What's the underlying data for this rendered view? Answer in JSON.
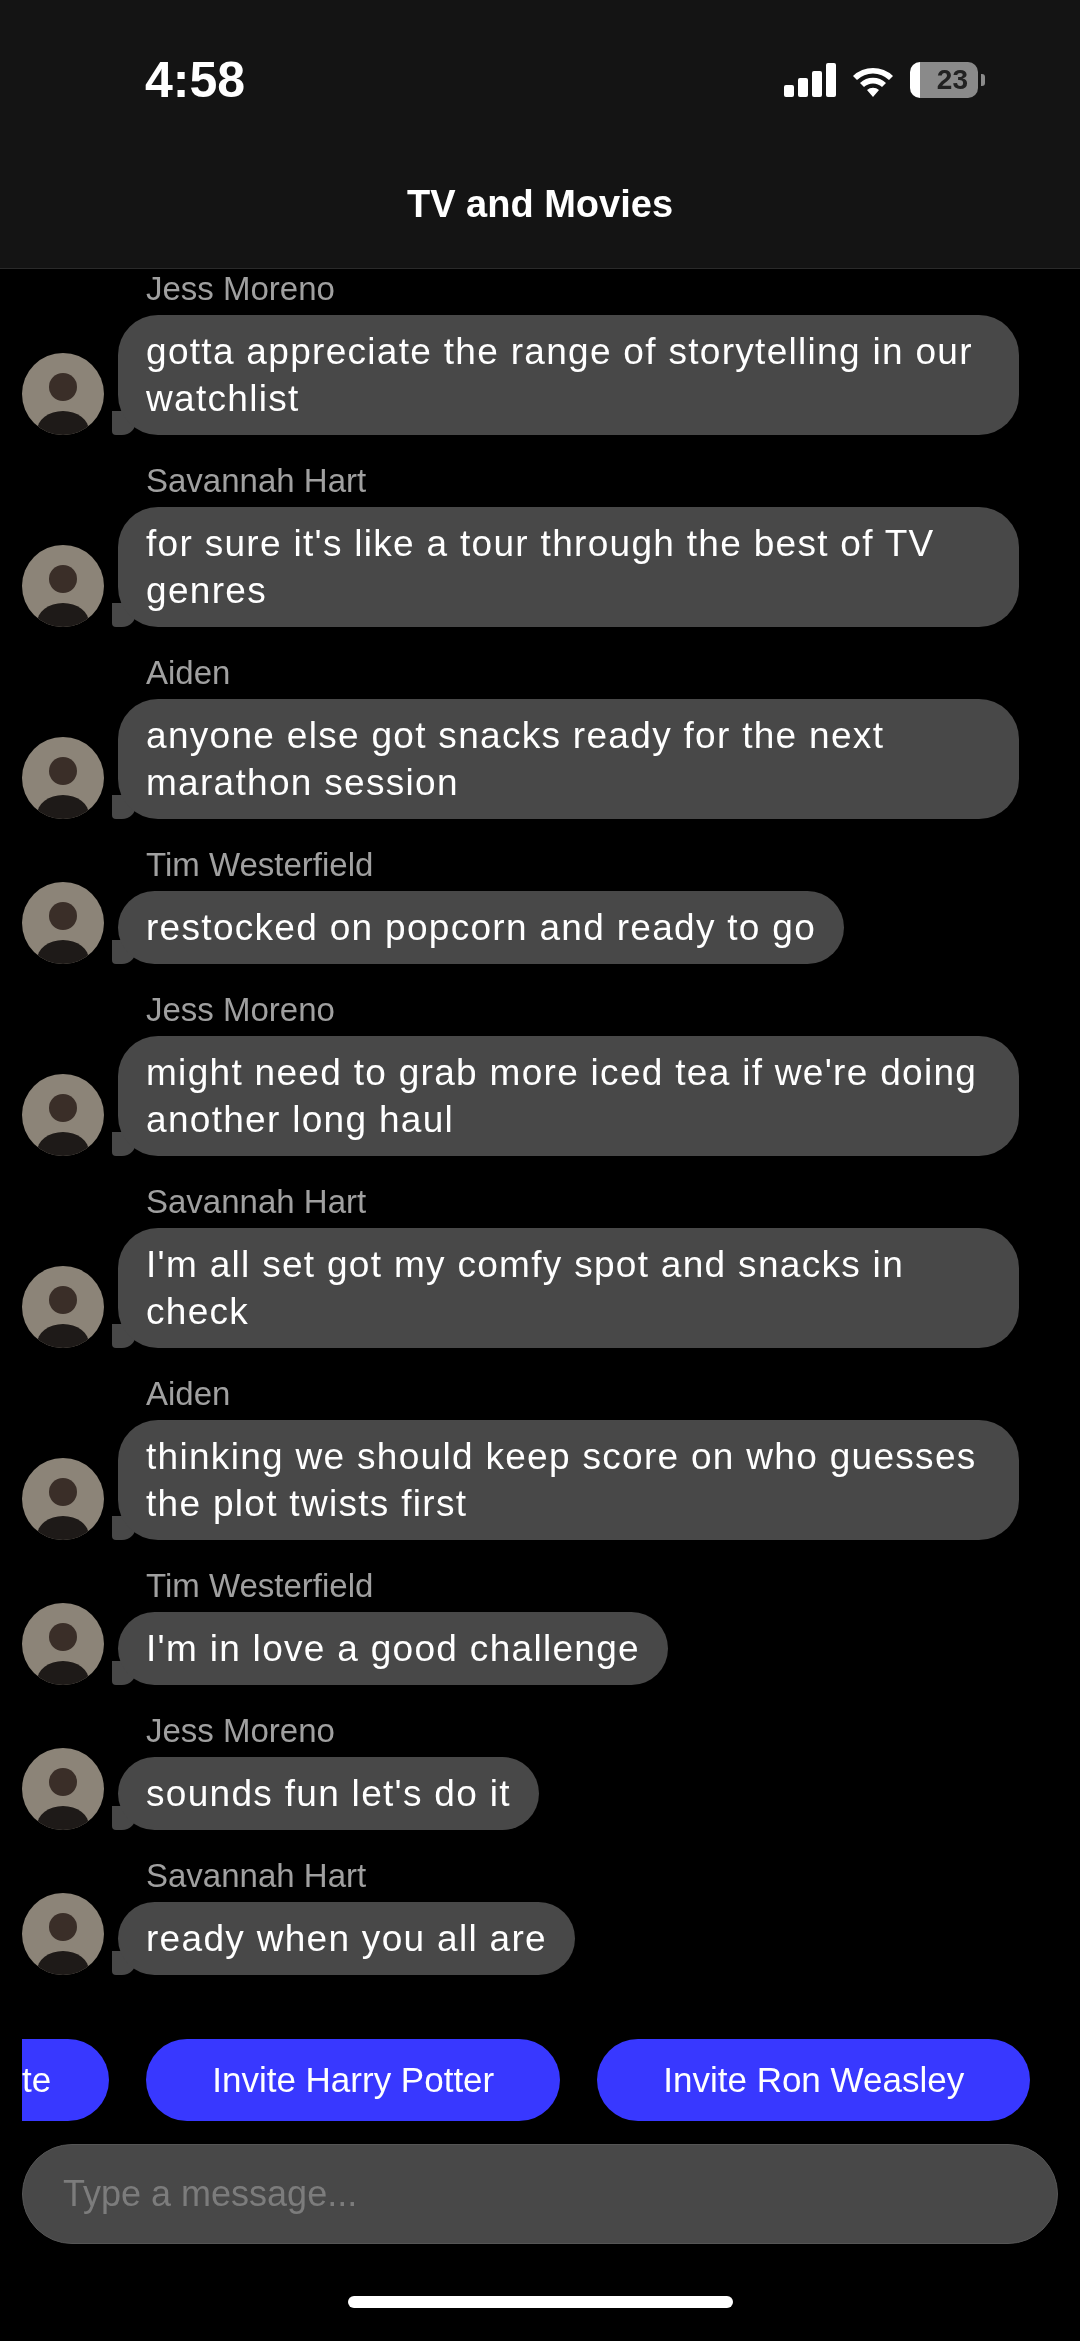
{
  "status_bar": {
    "time": "4:58",
    "battery": "23"
  },
  "header": {
    "title": "TV and Movies"
  },
  "messages": [
    {
      "sender": "Jess Moreno",
      "text": "gotta appreciate the range of storytelling in our watchlist"
    },
    {
      "sender": "Savannah Hart",
      "text": "for sure it's like a tour through the best of TV genres"
    },
    {
      "sender": "Aiden",
      "text": "anyone else got snacks ready for the next marathon session"
    },
    {
      "sender": "Tim Westerfield",
      "text": "restocked on popcorn and ready to go"
    },
    {
      "sender": "Jess Moreno",
      "text": "might need to grab more iced tea if we're doing another long haul"
    },
    {
      "sender": "Savannah Hart",
      "text": "I'm all set got my comfy spot and snacks in check"
    },
    {
      "sender": "Aiden",
      "text": "thinking we should keep score on who guesses the plot twists first"
    },
    {
      "sender": "Tim Westerfield",
      "text": "I'm in love a good challenge"
    },
    {
      "sender": "Jess Moreno",
      "text": "sounds fun let's do it"
    },
    {
      "sender": "Savannah Hart",
      "text": "ready when you all are"
    }
  ],
  "suggestions": [
    "te",
    "Invite Harry Potter",
    "Invite Ron Weasley"
  ],
  "composer": {
    "placeholder": "Type a message..."
  }
}
